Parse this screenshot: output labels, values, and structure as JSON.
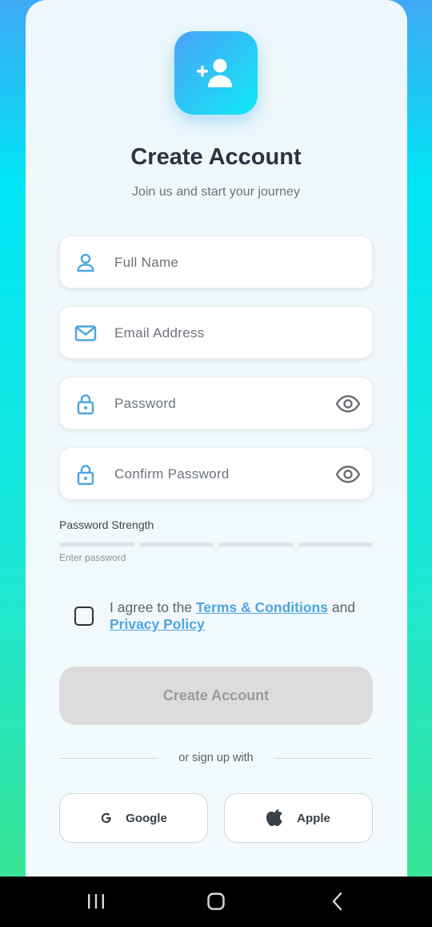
{
  "header": {
    "title": "Create Account",
    "subtitle": "Join us and start your journey",
    "logo_icon": "add-user-icon"
  },
  "form": {
    "full_name": {
      "placeholder": "Full Name",
      "icon": "person-icon"
    },
    "email": {
      "placeholder": "Email Address",
      "icon": "mail-icon"
    },
    "password": {
      "placeholder": "Password",
      "icon": "lock-icon",
      "toggle_icon": "eye-icon"
    },
    "confirm_password": {
      "placeholder": "Confirm Password",
      "icon": "lock-icon",
      "toggle_icon": "eye-icon"
    }
  },
  "strength": {
    "label": "Password Strength",
    "hint": "Enter password",
    "level": 0,
    "segments": 4
  },
  "agreement": {
    "checked": false,
    "prefix": "I agree to the ",
    "terms_link": "Terms & Conditions",
    "middle": " and ",
    "privacy_link": "Privacy Policy"
  },
  "submit": {
    "label": "Create Account",
    "enabled": false
  },
  "social": {
    "divider_text": "or sign up with",
    "google_label": "Google",
    "apple_label": "Apple"
  },
  "colors": {
    "accent": "#4ea5e0",
    "title": "#2b3441",
    "disabled_button": "#dcdcdc"
  },
  "system_nav": {
    "recents_icon": "recents-icon",
    "home_icon": "home-icon",
    "back_icon": "back-icon"
  }
}
